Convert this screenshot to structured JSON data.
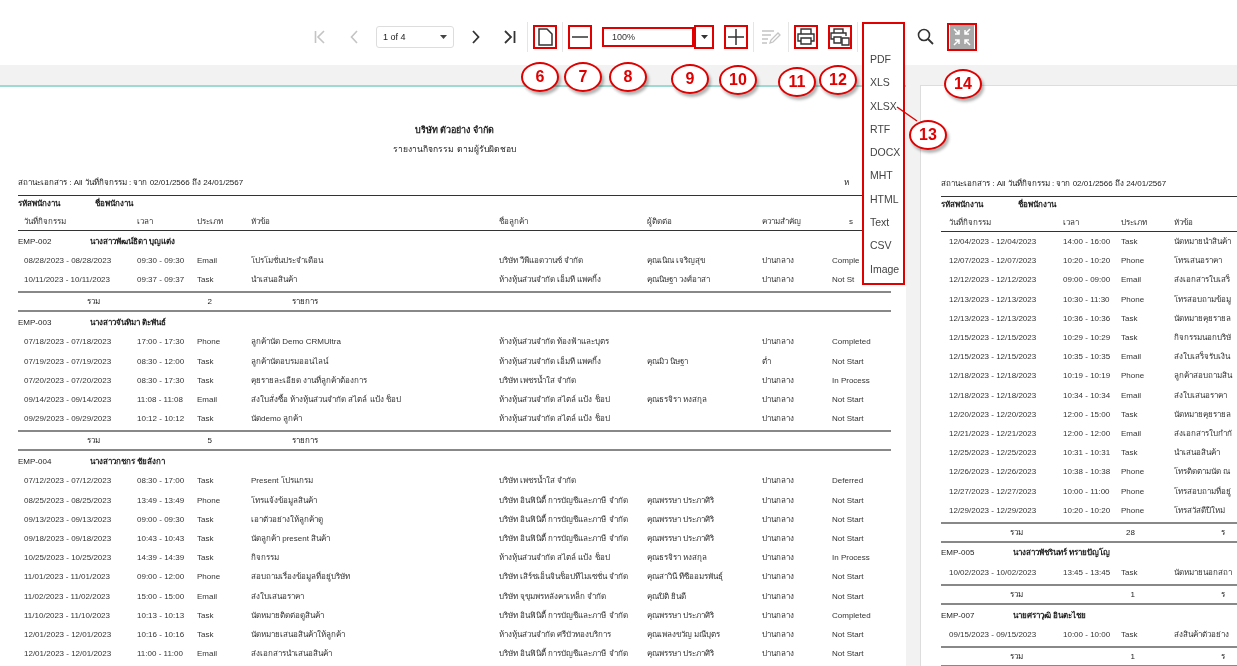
{
  "toolbar": [
    {
      "kind": "first",
      "disabled": true,
      "highlighted": false
    },
    {
      "kind": "prev",
      "disabled": true,
      "highlighted": false
    },
    {
      "kind": "page-select",
      "value": "1 of 4",
      "disabled": false,
      "highlighted": false
    },
    {
      "kind": "next",
      "disabled": false,
      "highlighted": false
    },
    {
      "kind": "last",
      "disabled": false,
      "highlighted": false
    },
    {
      "kind": "single-page",
      "disabled": false,
      "highlighted": true
    },
    {
      "kind": "zoom-out",
      "disabled": false,
      "highlighted": true
    },
    {
      "kind": "zoom-field",
      "value": "100%",
      "disabled": false,
      "highlighted": true
    },
    {
      "kind": "zoom-dropdown",
      "disabled": false,
      "highlighted": true
    },
    {
      "kind": "zoom-in",
      "disabled": false,
      "highlighted": true
    },
    {
      "kind": "edit",
      "disabled": true,
      "highlighted": false
    },
    {
      "kind": "print",
      "disabled": false,
      "highlighted": true
    },
    {
      "kind": "print-page",
      "disabled": false,
      "highlighted": true
    },
    {
      "kind": "search",
      "disabled": false,
      "highlighted": false
    },
    {
      "kind": "fullscreen",
      "disabled": false,
      "highlighted": true
    }
  ],
  "export_menu": {
    "highlighted": true,
    "items": [
      "PDF",
      "XLS",
      "XLSX",
      "RTF",
      "DOCX",
      "MHT",
      "HTML",
      "Text",
      "CSV",
      "Image"
    ]
  },
  "callouts": [
    {
      "label": "6"
    },
    {
      "label": "7"
    },
    {
      "label": "8"
    },
    {
      "label": "9"
    },
    {
      "label": "10"
    },
    {
      "label": "11"
    },
    {
      "label": "12"
    },
    {
      "label": "13"
    },
    {
      "label": "14"
    }
  ],
  "pages": [
    {
      "title": "บริษัท ตัวอย่าง จำกัด",
      "subtitle": "รายงานกิจกรรม ตามผู้รับผิดชอบ",
      "filter": "สถานะเอกสาร : All วันที่กิจกรรม : จาก 02/01/2566 ถึง 24/01/2567",
      "filter_right": "ห",
      "id_heading": "รหัสพนักงาน",
      "name_heading": "ชื่อพนักงาน",
      "columns": [
        "วันที่กิจกรรม",
        "เวลา",
        "ประเภท",
        "หัวข้อ",
        "ชื่อลูกค้า",
        "ผู้ติดต่อ",
        "ความสำคัญ",
        "s"
      ],
      "groups": [
        {
          "id": "EMP-002",
          "name": "นางสาวพัฒน์ธิดา บุญแต่ง",
          "rows": [
            {
              "date": "08/28/2023 - 08/28/2023",
              "time": "09:30 - 09:30",
              "type": "Email",
              "topic": "โปรโมชั่นประจำเดือน",
              "customer": "บริษัท วีพีแอดวานซ์ จำกัด",
              "contact": "คุณเนิณ เจริญสุข",
              "priority": "ปานกลาง",
              "status": "Comple"
            },
            {
              "date": "10/11/2023 - 10/11/2023",
              "time": "09:37 - 09:37",
              "type": "Task",
              "topic": "นำเสนอสินค้า",
              "customer": "ห้างหุ้นส่วนจำกัด เอ็มที แพคกิ้ง",
              "contact": "คุณนิษฐา วงศ์อาสา",
              "priority": "ปานกลาง",
              "status": "Not St"
            }
          ],
          "total_label": "รวม",
          "total": "2",
          "unit": "รายการ"
        },
        {
          "id": "EMP-003",
          "name": "นางสาวจันทิมา ติะพันธ์",
          "rows": [
            {
              "date": "07/18/2023 - 07/18/2023",
              "time": "17:00 - 17:30",
              "type": "Phone",
              "topic": "ลูกค้านัด Demo CRMUltra",
              "customer": "ห้างหุ้นส่วนจำกัด ท้องฟ้าและบุตร",
              "priority": "ปานกลาง",
              "status": "Completed"
            },
            {
              "date": "07/19/2023 - 07/19/2023",
              "time": "08:30 - 12:00",
              "type": "Task",
              "topic": "ลูกค้านัดอบรมออนไลน์",
              "customer": "ห้างหุ้นส่วนจำกัด เอ็มที แพคกิ้ง",
              "contact": "คุณมิว นิษฐา",
              "priority": "ต่ำ",
              "status": "Not Start"
            },
            {
              "date": "07/20/2023 - 07/20/2023",
              "time": "08:30 - 17:30",
              "type": "Task",
              "topic": "คุยรายละเอียด งานที่ลูกค้าต้องการ",
              "customer": "บริษัท เพชรน้ำใส จำกัด",
              "priority": "ปานกลาง",
              "status": "In Process"
            },
            {
              "date": "09/14/2023 - 09/14/2023",
              "time": "11:08 - 11:08",
              "type": "Email",
              "topic": "ส่งใบสั่งซื้อ ห้างหุ้นส่วนจำกัด สไตล์ แป้ง ช็อป",
              "customer": "ห้างหุ้นส่วนจำกัด สไตล์ แป้ง ช็อป",
              "contact": "คุณธรจิรา หงสกุล",
              "priority": "ปานกลาง",
              "status": "Not Start"
            },
            {
              "date": "09/29/2023 - 09/29/2023",
              "time": "10:12 - 10:12",
              "type": "Task",
              "topic": "นัดdemo ลูกค้า",
              "customer": "ห้างหุ้นส่วนจำกัด สไตล์ แป้ง ช็อป",
              "priority": "ปานกลาง",
              "status": "Not Start"
            }
          ],
          "total_label": "รวม",
          "total": "5",
          "unit": "รายการ"
        },
        {
          "id": "EMP-004",
          "name": "นางสาวกชกร ชัยลังกา",
          "rows": [
            {
              "date": "07/12/2023 - 07/12/2023",
              "time": "08:30 - 17:00",
              "type": "Task",
              "topic": "Present โปรแกรม",
              "customer": "บริษัท เพชรน้ำใส จำกัด",
              "priority": "ปานกลาง",
              "status": "Deferred"
            },
            {
              "date": "08/25/2023 - 08/25/2023",
              "time": "13:49 - 13:49",
              "type": "Phone",
              "topic": "โทรแจ้งข้อมูลสินค้า",
              "customer": "บริษัท อินฟินิตี้ การบัญชีและภาษี จำกัด",
              "contact": "คุณพรรษา ประภาศิริ",
              "priority": "ปานกลาง",
              "status": "Not Start"
            },
            {
              "date": "09/13/2023 - 09/13/2023",
              "time": "09:00 - 09:30",
              "type": "Task",
              "topic": "เอาตัวอย่างให้ลูกค้าดู",
              "customer": "บริษัท อินฟินิตี้ การบัญชีและภาษี จำกัด",
              "contact": "คุณพรรษา ประภาศิริ",
              "priority": "ปานกลาง",
              "status": "Not Start"
            },
            {
              "date": "09/18/2023 - 09/18/2023",
              "time": "10:43 - 10:43",
              "type": "Task",
              "topic": "นัดลูกค้า present สินค้า",
              "customer": "บริษัท อินฟินิตี้ การบัญชีและภาษี จำกัด",
              "contact": "คุณพรรษา ประภาศิริ",
              "priority": "ปานกลาง",
              "status": "Not Start"
            },
            {
              "date": "10/25/2023 - 10/25/2023",
              "time": "14:39 - 14:39",
              "type": "Task",
              "topic": "กิจกรรม",
              "customer": "ห้างหุ้นส่วนจำกัด สไตล์ แป้ง ช็อป",
              "contact": "คุณธรจิรา หงสกุล",
              "priority": "ปานกลาง",
              "status": "In Process"
            },
            {
              "date": "11/01/2023 - 11/01/2023",
              "time": "09:00 - 12:00",
              "type": "Phone",
              "topic": "สอบถามเรื่องข้อมูลที่อยู่บริษัท",
              "customer": "บริษัท เสิร์ชเอ็นจินช็อปทีไมเซชั่น จำกัด",
              "contact": "คุณสาวินี ทีซีออมรพันธุ์",
              "priority": "ปานกลาง",
              "status": "Not Start"
            },
            {
              "date": "11/02/2023 - 11/02/2023",
              "time": "15:00 - 15:00",
              "type": "Email",
              "topic": "ส่งใบเสนอราคา",
              "customer": "บริษัท จุขุมพรหลังคาเหล็ก จำกัด",
              "contact": "คุณปิติ ยินดี",
              "priority": "ปานกลาง",
              "status": "Not Start"
            },
            {
              "date": "11/10/2023 - 11/10/2023",
              "time": "10:13 - 10:13",
              "type": "Task",
              "topic": "นัดหมายติดต่อดูสินค้า",
              "customer": "บริษัท อินฟินิตี้ การบัญชีและภาษี จำกัด",
              "contact": "คุณพรรษา ประภาศิริ",
              "priority": "ปานกลาง",
              "status": "Completed"
            },
            {
              "date": "12/01/2023 - 12/01/2023",
              "time": "10:16 - 10:16",
              "type": "Task",
              "topic": "นัดหมายเสนอสินค้าให้ลูกค้า",
              "customer": "ห้างหุ้นส่วนจำกัด ศรีบัวทองบริการ",
              "contact": "คุณเพลงขวัญ มณีบุตร",
              "priority": "ปานกลาง",
              "status": "Not Start"
            },
            {
              "date": "12/01/2023 - 12/01/2023",
              "time": "11:00 - 11:00",
              "type": "Email",
              "topic": "ส่งเอกสารนำเสนอสินค้า",
              "customer": "บริษัท อินฟินิตี้ การบัญชีและภาษี จำกัด",
              "contact": "คุณพรรษา ประภาศิริ",
              "priority": "ปานกลาง",
              "status": "Not Start"
            }
          ]
        }
      ]
    },
    {
      "filter": "สถานะเอกสาร : All วันที่กิจกรรม : จาก 02/01/2566 ถึง 24/01/2567",
      "id_heading": "รหัสพนักงาน",
      "name_heading": "ชื่อพนักงาน",
      "columns": [
        "วันที่กิจกรรม",
        "เวลา",
        "ประเภท",
        "หัวข้อ"
      ],
      "groups": [
        {
          "rows": [
            {
              "date": "12/04/2023 - 12/04/2023",
              "time": "14:00 - 16:00",
              "type": "Task",
              "topic": "นัดหมายนำสินค้า"
            },
            {
              "date": "12/07/2023 - 12/07/2023",
              "time": "10:20 - 10:20",
              "type": "Phone",
              "topic": "โทรเสนอราคา"
            },
            {
              "date": "12/12/2023 - 12/12/2023",
              "time": "09:00 - 09:00",
              "type": "Email",
              "topic": "ส่งเอกสารใบเสร็"
            },
            {
              "date": "12/13/2023 - 12/13/2023",
              "time": "10:30 - 11:30",
              "type": "Phone",
              "topic": "โทรสอบถามข้อมู"
            },
            {
              "date": "12/13/2023 - 12/13/2023",
              "time": "10:36 - 10:36",
              "type": "Task",
              "topic": "นัดหมายคุยรายล"
            },
            {
              "date": "12/15/2023 - 12/15/2023",
              "time": "10:29 - 10:29",
              "type": "Task",
              "topic": "กิจกรรมนอกบริษั"
            },
            {
              "date": "12/15/2023 - 12/15/2023",
              "time": "10:35 - 10:35",
              "type": "Email",
              "topic": "ส่งใบเสร็จรับเงิน"
            },
            {
              "date": "12/18/2023 - 12/18/2023",
              "time": "10:19 - 10:19",
              "type": "Phone",
              "topic": "ลูกค้าสอบถามสิน"
            },
            {
              "date": "12/18/2023 - 12/18/2023",
              "time": "10:34 - 10:34",
              "type": "Email",
              "topic": "ส่งใบเสนอราคา"
            },
            {
              "date": "12/20/2023 - 12/20/2023",
              "time": "12:00 - 15:00",
              "type": "Task",
              "topic": "นัดหมายคุยรายล"
            },
            {
              "date": "12/21/2023 - 12/21/2023",
              "time": "12:00 - 12:00",
              "type": "Email",
              "topic": "ส่งเอกสารใบกำกั"
            },
            {
              "date": "12/25/2023 - 12/25/2023",
              "time": "10:31 - 10:31",
              "type": "Task",
              "topic": "นำเสนอสินค้า"
            },
            {
              "date": "12/26/2023 - 12/26/2023",
              "time": "10:38 - 10:38",
              "type": "Phone",
              "topic": "โทรติดตามนัด ณ"
            },
            {
              "date": "12/27/2023 - 12/27/2023",
              "time": "10:00 - 11:00",
              "type": "Phone",
              "topic": "โทรสอบถามที่อยู่"
            },
            {
              "date": "12/29/2023 - 12/29/2023",
              "time": "10:20 - 10:20",
              "type": "Phone",
              "topic": "โทรสวัสดีปีใหม่"
            }
          ],
          "total_label": "รวม",
          "total": "28",
          "unit": "ร"
        },
        {
          "id": "EMP-005",
          "name": "นางสาวพัชรินทร์ ทรายปัญโญ",
          "rows": [
            {
              "date": "10/02/2023 - 10/02/2023",
              "time": "13:45 - 13:45",
              "type": "Task",
              "topic": "นัดหมายนอกสถา"
            }
          ],
          "total_label": "รวม",
          "total": "1",
          "unit": "ร"
        },
        {
          "id": "EMP-007",
          "name": "นายศราวุฒิ อินตะไชย",
          "rows": [
            {
              "date": "09/15/2023 - 09/15/2023",
              "time": "10:00 - 10:00",
              "type": "Task",
              "topic": "ส่งสินค้าตัวอย่าง"
            }
          ],
          "total_label": "รวม",
          "total": "1",
          "unit": "ร"
        }
      ]
    }
  ]
}
